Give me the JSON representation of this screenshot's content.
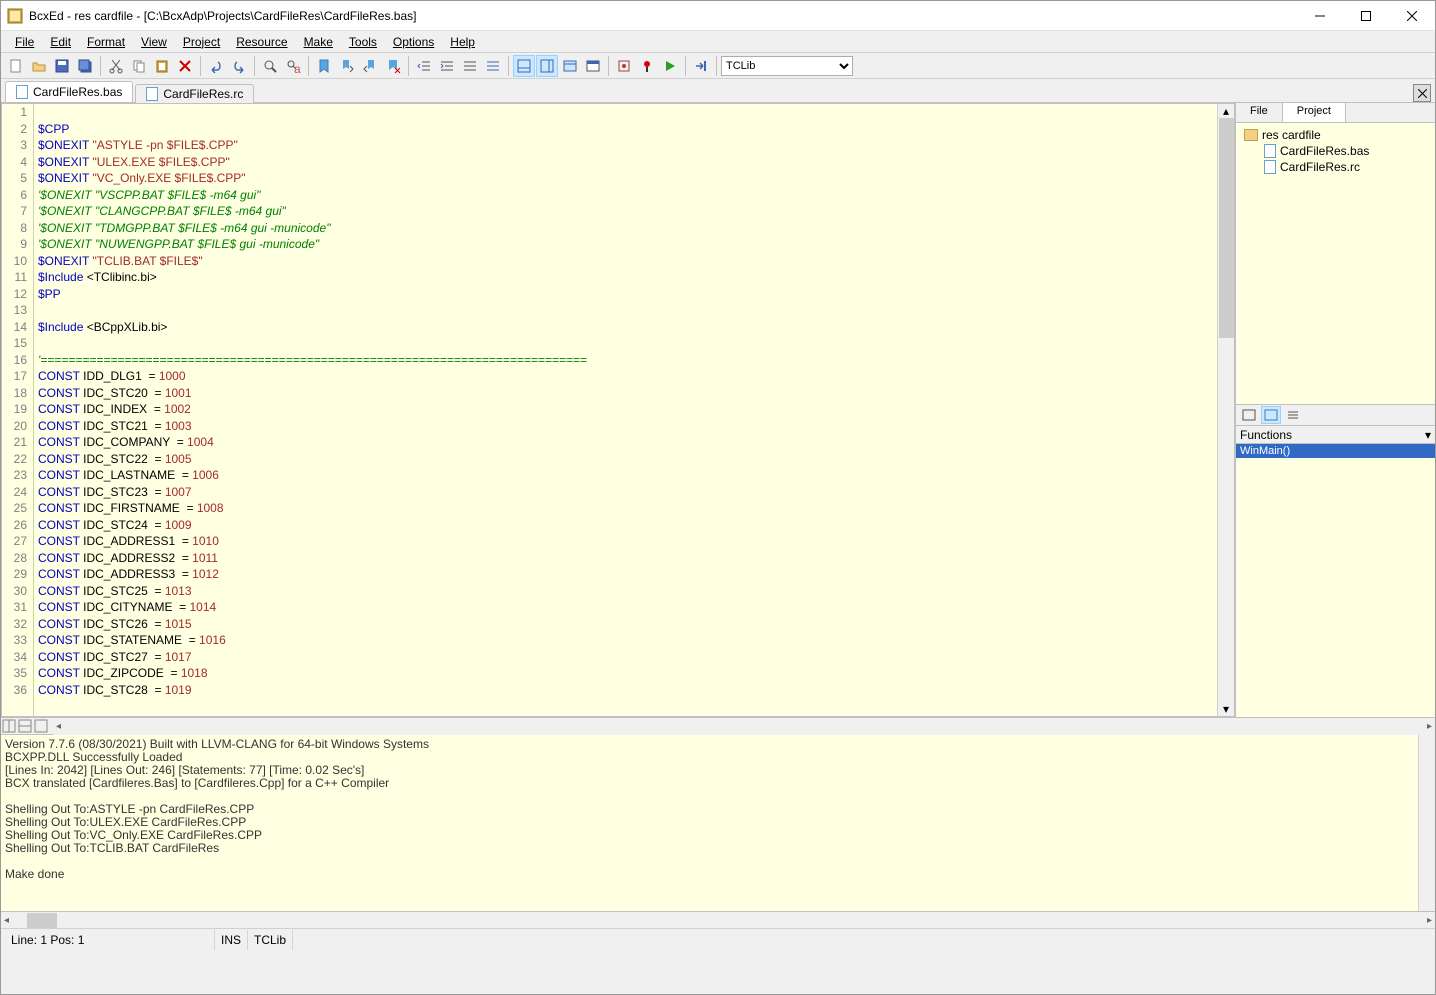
{
  "window": {
    "title": "BcxEd - res cardfile - [C:\\BcxAdp\\Projects\\CardFileRes\\CardFileRes.bas]"
  },
  "menu": {
    "file": "File",
    "edit": "Edit",
    "format": "Format",
    "view": "View",
    "project": "Project",
    "resource": "Resource",
    "make": "Make",
    "tools": "Tools",
    "options": "Options",
    "help": "Help"
  },
  "toolbar": {
    "combo_value": "TCLib"
  },
  "tabs": {
    "t1": "CardFileRes.bas",
    "t2": "CardFileRes.rc"
  },
  "right_tabs": {
    "file": "File",
    "project": "Project"
  },
  "tree": {
    "root": "res cardfile",
    "f1": "CardFileRes.bas",
    "f2": "CardFileRes.rc"
  },
  "funcpanel": {
    "header": "Functions",
    "item1": "WinMain()"
  },
  "status": {
    "pos": "Line: 1 Pos: 1",
    "ins": "INS",
    "mode": "TCLib"
  },
  "code": {
    "lines": [
      {
        "n": "1",
        "t": ""
      },
      {
        "n": "2",
        "t": "<span class='kw'>$CPP</span>"
      },
      {
        "n": "3",
        "t": "<span class='kw'>$ONEXIT</span> <span class='str'>\"ASTYLE -pn $FILE$.CPP\"</span>"
      },
      {
        "n": "4",
        "t": "<span class='kw'>$ONEXIT</span> <span class='str'>\"ULEX.EXE $FILE$.CPP\"</span>"
      },
      {
        "n": "5",
        "t": "<span class='kw'>$ONEXIT</span> <span class='str'>\"VC_Only.EXE $FILE$.CPP\"</span>"
      },
      {
        "n": "6",
        "t": "<span class='cmt'>'$ONEXIT \"VSCPP.BAT $FILE$ -m64 gui\"</span>"
      },
      {
        "n": "7",
        "t": "<span class='cmt'>'$ONEXIT \"CLANGCPP.BAT $FILE$ -m64 gui\"</span>"
      },
      {
        "n": "8",
        "t": "<span class='cmt'>'$ONEXIT \"TDMGPP.BAT $FILE$ -m64 gui -municode\"</span>"
      },
      {
        "n": "9",
        "t": "<span class='cmt'>'$ONEXIT \"NUWENGPP.BAT $FILE$ gui -municode\"</span>"
      },
      {
        "n": "10",
        "t": "<span class='kw'>$ONEXIT</span> <span class='str'>\"TCLIB.BAT $FILE$\"</span>"
      },
      {
        "n": "11",
        "t": "<span class='kw'>$Include</span> &lt;TClibinc.bi&gt;"
      },
      {
        "n": "12",
        "t": "<span class='kw'>$PP</span>"
      },
      {
        "n": "13",
        "t": ""
      },
      {
        "n": "14",
        "t": "<span class='kw'>$Include</span> &lt;BCppXLib.bi&gt;"
      },
      {
        "n": "15",
        "t": ""
      },
      {
        "n": "16",
        "t": "<span class='cmt'>'==============================================================================</span>"
      },
      {
        "n": "17",
        "t": "<span class='kw'>CONST</span> IDD_DLG1  = <span class='num'>1000</span>"
      },
      {
        "n": "18",
        "t": "<span class='kw'>CONST</span> IDC_STC20  = <span class='num'>1001</span>"
      },
      {
        "n": "19",
        "t": "<span class='kw'>CONST</span> IDC_INDEX  = <span class='num'>1002</span>"
      },
      {
        "n": "20",
        "t": "<span class='kw'>CONST</span> IDC_STC21  = <span class='num'>1003</span>"
      },
      {
        "n": "21",
        "t": "<span class='kw'>CONST</span> IDC_COMPANY  = <span class='num'>1004</span>"
      },
      {
        "n": "22",
        "t": "<span class='kw'>CONST</span> IDC_STC22  = <span class='num'>1005</span>"
      },
      {
        "n": "23",
        "t": "<span class='kw'>CONST</span> IDC_LASTNAME  = <span class='num'>1006</span>"
      },
      {
        "n": "24",
        "t": "<span class='kw'>CONST</span> IDC_STC23  = <span class='num'>1007</span>"
      },
      {
        "n": "25",
        "t": "<span class='kw'>CONST</span> IDC_FIRSTNAME  = <span class='num'>1008</span>"
      },
      {
        "n": "26",
        "t": "<span class='kw'>CONST</span> IDC_STC24  = <span class='num'>1009</span>"
      },
      {
        "n": "27",
        "t": "<span class='kw'>CONST</span> IDC_ADDRESS1  = <span class='num'>1010</span>"
      },
      {
        "n": "28",
        "t": "<span class='kw'>CONST</span> IDC_ADDRESS2  = <span class='num'>1011</span>"
      },
      {
        "n": "29",
        "t": "<span class='kw'>CONST</span> IDC_ADDRESS3  = <span class='num'>1012</span>"
      },
      {
        "n": "30",
        "t": "<span class='kw'>CONST</span> IDC_STC25  = <span class='num'>1013</span>"
      },
      {
        "n": "31",
        "t": "<span class='kw'>CONST</span> IDC_CITYNAME  = <span class='num'>1014</span>"
      },
      {
        "n": "32",
        "t": "<span class='kw'>CONST</span> IDC_STC26  = <span class='num'>1015</span>"
      },
      {
        "n": "33",
        "t": "<span class='kw'>CONST</span> IDC_STATENAME  = <span class='num'>1016</span>"
      },
      {
        "n": "34",
        "t": "<span class='kw'>CONST</span> IDC_STC27  = <span class='num'>1017</span>"
      },
      {
        "n": "35",
        "t": "<span class='kw'>CONST</span> IDC_ZIPCODE  = <span class='num'>1018</span>"
      },
      {
        "n": "36",
        "t": "<span class='kw'>CONST</span> IDC_STC28  = <span class='num'>1019</span>"
      }
    ]
  },
  "output": {
    "lines": [
      "Version 7.7.6 (08/30/2021) Built with LLVM-CLANG for 64-bit Windows Systems",
      "BCXPP.DLL Successfully Loaded",
      "[Lines In: 2042] [Lines Out: 246] [Statements: 77] [Time: 0.02 Sec's]",
      "BCX translated [Cardfileres.Bas] to [Cardfileres.Cpp] for a C++ Compiler",
      "",
      "Shelling Out To:ASTYLE -pn CardFileRes.CPP",
      "Shelling Out To:ULEX.EXE CardFileRes.CPP",
      "Shelling Out To:VC_Only.EXE CardFileRes.CPP",
      "Shelling Out To:TCLIB.BAT CardFileRes",
      "",
      "Make done"
    ]
  }
}
